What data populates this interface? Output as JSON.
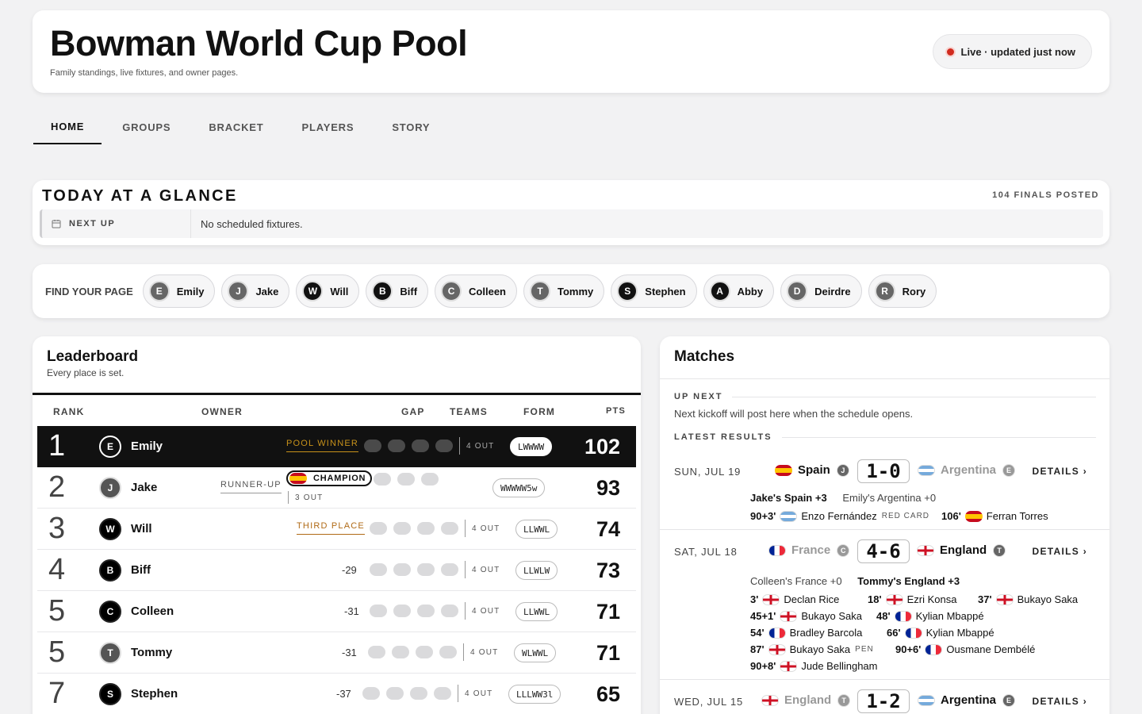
{
  "header": {
    "title": "Bowman World Cup Pool",
    "subtitle": "Family standings, live fixtures, and owner pages.",
    "live": "Live · updated just now",
    "colors": {
      "live_dot": "#d12b1f"
    }
  },
  "tabs": [
    "HOME",
    "GROUPS",
    "BRACKET",
    "PLAYERS",
    "STORY"
  ],
  "glance": {
    "title": "TODAY AT A GLANCE",
    "finals": "104 FINALS POSTED",
    "next_label": "NEXT UP",
    "next_value": "No scheduled fixtures."
  },
  "find": {
    "label": "FIND YOUR PAGE",
    "people": [
      {
        "initial": "E",
        "name": "Emily"
      },
      {
        "initial": "J",
        "name": "Jake"
      },
      {
        "initial": "W",
        "name": "Will"
      },
      {
        "initial": "B",
        "name": "Biff"
      },
      {
        "initial": "C",
        "name": "Colleen"
      },
      {
        "initial": "T",
        "name": "Tommy"
      },
      {
        "initial": "S",
        "name": "Stephen"
      },
      {
        "initial": "A",
        "name": "Abby"
      },
      {
        "initial": "D",
        "name": "Deirdre"
      },
      {
        "initial": "R",
        "name": "Rory"
      }
    ]
  },
  "leaderboard": {
    "title": "Leaderboard",
    "subtitle": "Every place is set.",
    "columns": {
      "rank": "RANK",
      "owner": "OWNER",
      "gap": "GAP",
      "teams": "TEAMS",
      "form": "FORM",
      "pts": "PTS"
    },
    "rows": [
      {
        "rank": "1",
        "initial": "E",
        "name": "Emily",
        "badge": "POOL WINNER",
        "gap": "",
        "out": "4 OUT",
        "form": "LWWWW",
        "pts": "102"
      },
      {
        "rank": "2",
        "initial": "J",
        "name": "Jake",
        "badge": "RUNNER-UP",
        "champion": "CHAMPION",
        "gap": "",
        "out": "3 OUT",
        "form": "WWWWW5w",
        "pts": "93"
      },
      {
        "rank": "3",
        "initial": "W",
        "name": "Will",
        "badge": "THIRD PLACE",
        "gap": "",
        "out": "4 OUT",
        "form": "LLWWL",
        "pts": "74"
      },
      {
        "rank": "4",
        "initial": "B",
        "name": "Biff",
        "badge": "",
        "gap": "-29",
        "out": "4 OUT",
        "form": "LLWLW",
        "pts": "73"
      },
      {
        "rank": "5",
        "initial": "C",
        "name": "Colleen",
        "badge": "",
        "gap": "-31",
        "out": "4 OUT",
        "form": "LLWWL",
        "pts": "71"
      },
      {
        "rank": "5",
        "initial": "T",
        "name": "Tommy",
        "badge": "",
        "gap": "-31",
        "out": "4 OUT",
        "form": "WLWWL",
        "pts": "71"
      },
      {
        "rank": "7",
        "initial": "S",
        "name": "Stephen",
        "badge": "",
        "gap": "-37",
        "out": "4 OUT",
        "form": "LLLWW3l",
        "pts": "65"
      }
    ]
  },
  "matches": {
    "title": "Matches",
    "up_next_label": "UP NEXT",
    "up_next_note": "Next kickoff will post here when the schedule opens.",
    "latest_label": "LATEST RESULTS",
    "details": "DETAILS ›",
    "list": [
      {
        "date": "SUN, JUL 19",
        "home": "Spain",
        "home_owner": "J",
        "score": "1-0",
        "away": "Argentina",
        "away_owner": "E",
        "owner_home": "Jake's Spain +3",
        "owner_away": "Emily's Argentina +0",
        "events": [
          {
            "min": "90+3'",
            "player": "Enzo Fernández",
            "tag": "RED CARD"
          },
          {
            "min": "106'",
            "player": "Ferran Torres",
            "tag": ""
          }
        ]
      },
      {
        "date": "SAT, JUL 18",
        "home": "France",
        "home_owner": "C",
        "score": "4-6",
        "away": "England",
        "away_owner": "T",
        "owner_home": "Colleen's France +0",
        "owner_away": "Tommy's England +3",
        "events": [
          {
            "min": "3'",
            "player": "Declan Rice",
            "tag": ""
          },
          {
            "min": "18'",
            "player": "Ezri Konsa",
            "tag": ""
          },
          {
            "min": "37'",
            "player": "Bukayo Saka",
            "tag": ""
          },
          {
            "min": "45+1'",
            "player": "Bukayo Saka",
            "tag": ""
          },
          {
            "min": "48'",
            "player": "Kylian Mbappé",
            "tag": ""
          },
          {
            "min": "54'",
            "player": "Bradley Barcola",
            "tag": ""
          },
          {
            "min": "66'",
            "player": "Kylian Mbappé",
            "tag": ""
          },
          {
            "min": "87'",
            "player": "Bukayo Saka",
            "tag": "PEN"
          },
          {
            "min": "90+6'",
            "player": "Ousmane Dembélé",
            "tag": ""
          },
          {
            "min": "90+8'",
            "player": "Jude Bellingham",
            "tag": ""
          }
        ]
      },
      {
        "date": "WED, JUL 15",
        "home": "England",
        "home_owner": "T",
        "score": "1-2",
        "away": "Argentina",
        "away_owner": "E"
      }
    ]
  }
}
